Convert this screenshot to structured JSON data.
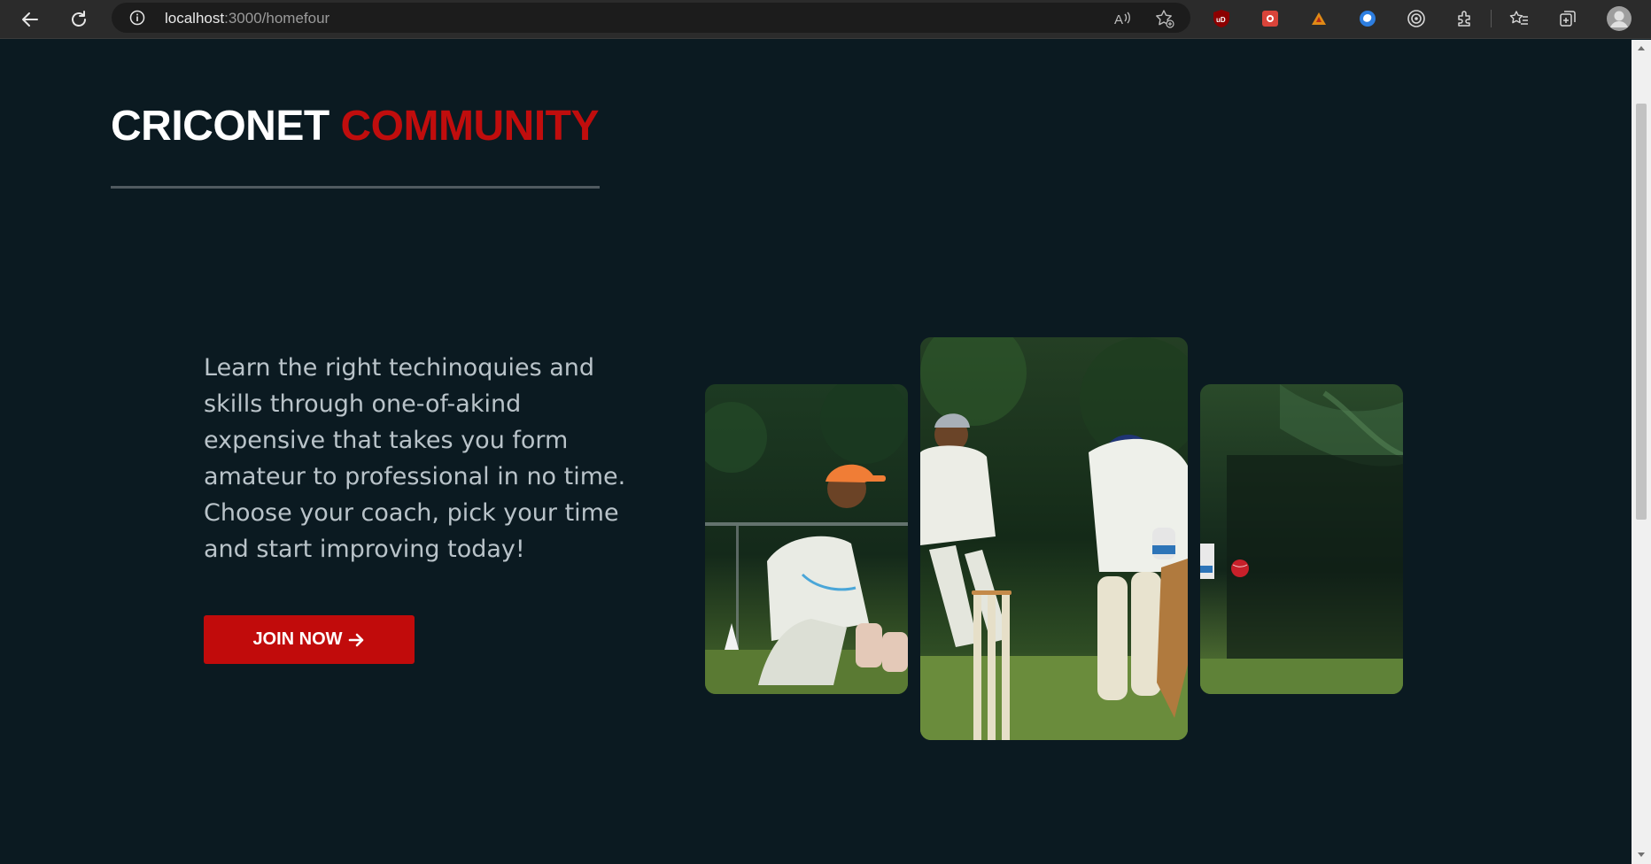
{
  "browser": {
    "url_host": "localhost",
    "url_path": ":3000/homefour",
    "extensions": [
      "ublock-origin-icon",
      "extension-puzzle-red-icon",
      "extension-orange-icon",
      "extension-blue-circle-icon",
      "extension-target-icon"
    ]
  },
  "hero": {
    "brand_primary": "CRICONET",
    "brand_accent": "COMMUNITY",
    "lead": "Learn the right techinoquies and skills through one-of-akind expensive that takes you form amateur to professional in no time. Choose your coach, pick your time and start improving today!",
    "cta_label": "JOIN NOW",
    "cta_icon": "arrow-right-icon"
  },
  "colors": {
    "background": "#0b1a21",
    "accent": "#c10b0b",
    "text_muted": "#b9c3c9"
  },
  "gallery": {
    "images": [
      "wicketkeeper-photo",
      "fielder-and-stumps-photo",
      "batsman-photo"
    ]
  }
}
